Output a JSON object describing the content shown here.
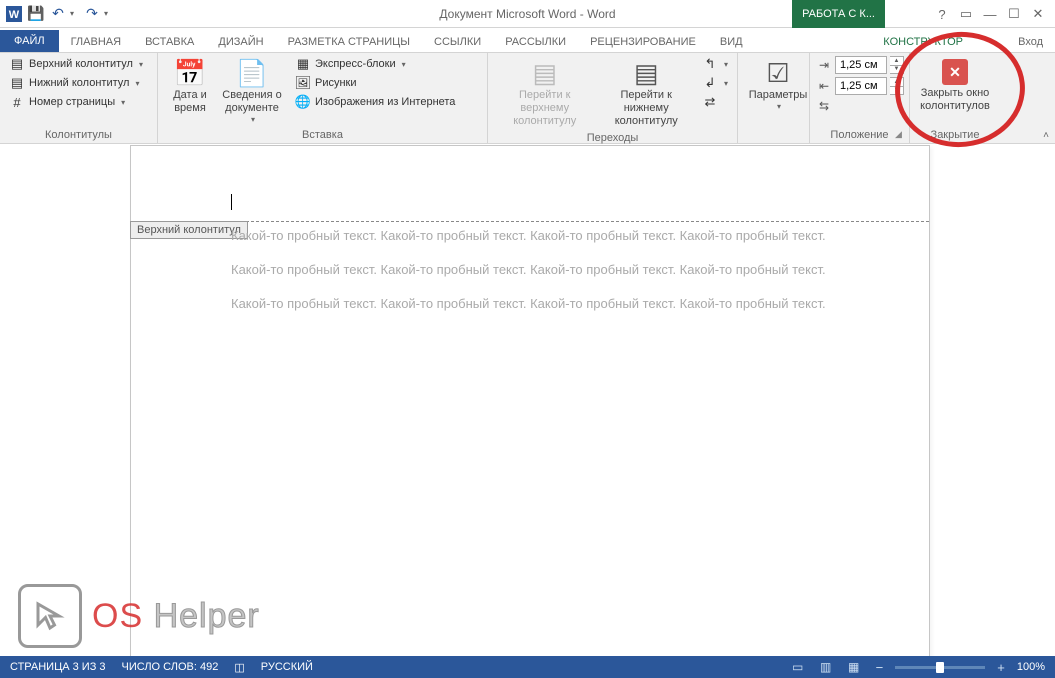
{
  "titlebar": {
    "title": "Документ Microsoft Word - Word",
    "context_tab": "РАБОТА С К...",
    "signin": "Вход"
  },
  "tabs": {
    "file": "ФАЙЛ",
    "items": [
      "ГЛАВНАЯ",
      "ВСТАВКА",
      "ДИЗАЙН",
      "РАЗМЕТКА СТРАНИЦЫ",
      "ССЫЛКИ",
      "РАССЫЛКИ",
      "РЕЦЕНЗИРОВАНИЕ",
      "ВИД"
    ],
    "active": "КОНСТРУКТОР"
  },
  "ribbon": {
    "hf_group": {
      "header": "Верхний колонтитул",
      "footer": "Нижний колонтитул",
      "pagenum": "Номер страницы",
      "label": "Колонтитулы"
    },
    "insert_group": {
      "datetime": "Дата и время",
      "docinfo": "Сведения о документе",
      "quickparts": "Экспресс-блоки",
      "pictures": "Рисунки",
      "onlinepics": "Изображения из Интернета",
      "label": "Вставка"
    },
    "nav_group": {
      "goto_header": "Перейти к верхнему колонтитулу",
      "goto_footer": "Перейти к нижнему колонтитулу",
      "label": "Переходы"
    },
    "options_group": {
      "options": "Параметры",
      "label": ""
    },
    "position_group": {
      "top_value": "1,25 см",
      "bottom_value": "1,25 см",
      "label": "Положение"
    },
    "close_group": {
      "close_label": "Закрыть окно колонтитулов",
      "label": "Закрытие"
    }
  },
  "document": {
    "header_tag": "Верхний колонтитул",
    "paragraph": "Какой-то пробный текст. Какой-то пробный текст. Какой-то пробный текст. Какой-то пробный текст."
  },
  "statusbar": {
    "page": "СТРАНИЦА 3 ИЗ 3",
    "words": "ЧИСЛО СЛОВ: 492",
    "lang": "РУССКИЙ",
    "zoom": "100%"
  },
  "watermark": {
    "os": "OS",
    "helper": " Helper"
  }
}
